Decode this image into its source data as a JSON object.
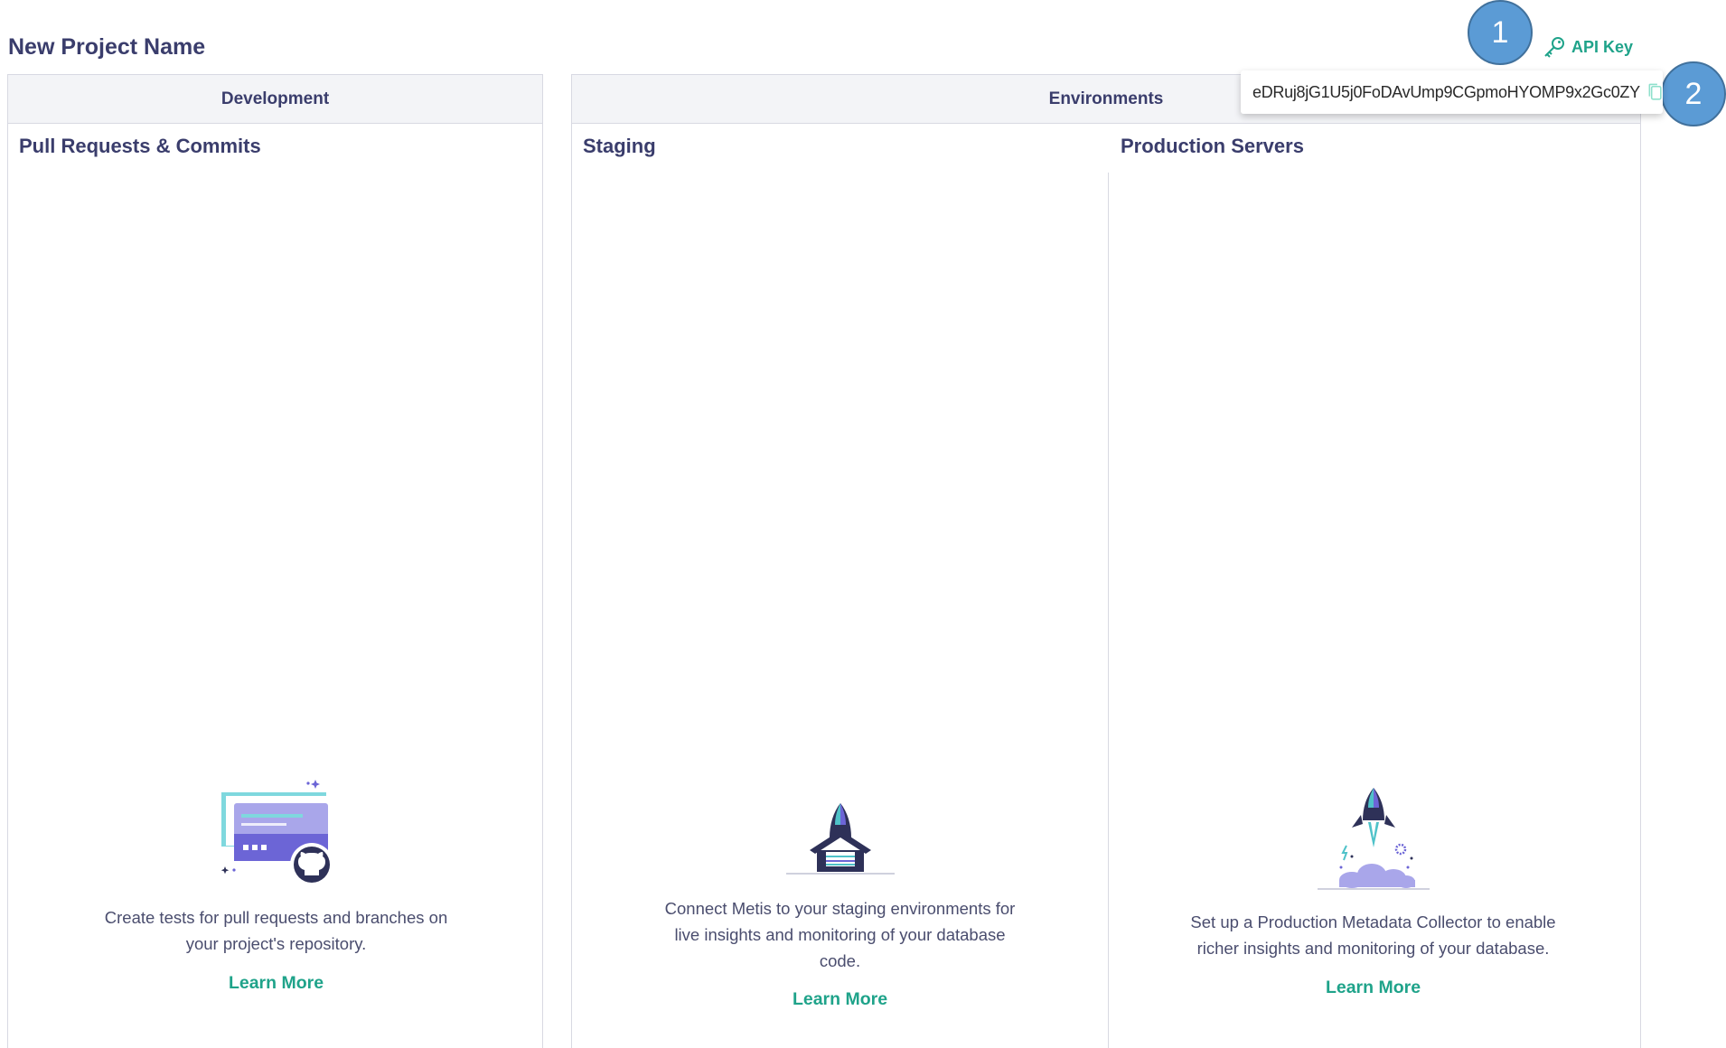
{
  "project": {
    "title": "New Project Name"
  },
  "api_key": {
    "link_label": "API Key",
    "value": "eDRuj8jG1U5j0FoDAvUmp9CGpmoHYOMP9x2Gc0ZY",
    "icon": "key-icon",
    "copy_icon": "copy-icon"
  },
  "callouts": [
    "1",
    "2"
  ],
  "development": {
    "header": "Development",
    "section_title": "Pull Requests & Commits",
    "description_line1": "Create tests for pull requests and branches on",
    "description_line2": "your project's repository.",
    "learn_more": "Learn More"
  },
  "environments": {
    "header": "Environments",
    "staging": {
      "title": "Staging",
      "description_line1": "Connect Metis to your staging environments for",
      "description_line2": "live insights and monitoring of your database",
      "description_line3": "code.",
      "learn_more": "Learn More"
    },
    "production": {
      "title": "Production Servers",
      "description_line1": "Set up a Production Metadata Collector to enable",
      "description_line2": "richer insights and monitoring of your database.",
      "learn_more": "Learn More"
    }
  },
  "colors": {
    "accent": "#1fa38a",
    "heading": "#3a3d6c",
    "callout": "#5b9bd5"
  }
}
